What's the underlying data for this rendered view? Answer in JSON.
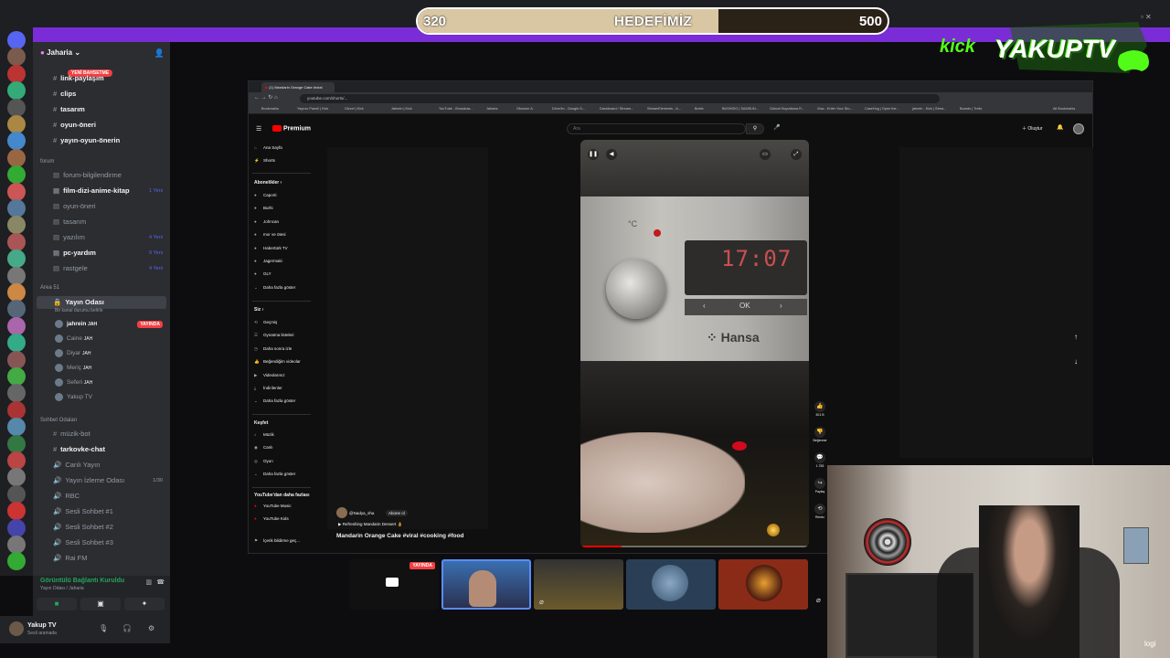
{
  "goal": {
    "current": "320",
    "label": "HEDEFİMİZ",
    "max": "500",
    "progress": 0.64
  },
  "kick_label": "kick",
  "logo_text": "YAKUPTV",
  "discord": {
    "server_name": "Jaharia",
    "new_badge": "YENİ BAHSETME",
    "channels": [
      {
        "label": "link-paylaşım",
        "bold": true
      },
      {
        "label": "clips",
        "bold": true
      },
      {
        "label": "tasarım",
        "bold": true
      },
      {
        "label": "oyun-öneri",
        "bold": true
      },
      {
        "label": "yayın-oyun-önerin",
        "bold": true
      }
    ],
    "forum_cat": "forum",
    "forum": [
      {
        "label": "forum-bilgilendirme",
        "bold": false,
        "count": ""
      },
      {
        "label": "film-dizi-anime-kitap",
        "bold": true,
        "count": "1 Yeni"
      },
      {
        "label": "oyun-öneri",
        "bold": false,
        "count": ""
      },
      {
        "label": "tasarım",
        "bold": false,
        "count": ""
      },
      {
        "label": "yazılım",
        "bold": false,
        "count": "4 Yeni"
      },
      {
        "label": "pc-yardım",
        "bold": true,
        "count": "9 Yeni"
      },
      {
        "label": "rastgele",
        "bold": false,
        "count": "4 Yeni"
      }
    ],
    "area_cat": "Area 51",
    "voice_room": "Yayın Odası",
    "voice_status": "Bir kanal durumu belirle",
    "voice_users": [
      {
        "name": "jahrein",
        "tag": "JAH",
        "live": "YAYINDA"
      },
      {
        "name": "Caine",
        "tag": "JAH",
        "live": ""
      },
      {
        "name": "Diyar",
        "tag": "JAH",
        "live": ""
      },
      {
        "name": "Meriç",
        "tag": "JAH",
        "live": ""
      },
      {
        "name": "Seferi",
        "tag": "JAH",
        "live": ""
      },
      {
        "name": "Yakup TV",
        "tag": "",
        "live": ""
      }
    ],
    "chat_cat": "Sohbet Odaları",
    "chat": [
      {
        "label": "müzik-bot",
        "bold": false,
        "count": ""
      },
      {
        "label": "tarkovke-chat",
        "bold": true,
        "count": ""
      },
      {
        "label": "Canlı Yayın",
        "bold": false,
        "count": ""
      },
      {
        "label": "Yayın İzleme Odası",
        "bold": false,
        "count": "1/30"
      },
      {
        "label": "RBC",
        "bold": false,
        "count": ""
      },
      {
        "label": "Sesli Sohbet #1",
        "bold": false,
        "count": ""
      },
      {
        "label": "Sesli Sohbet #2",
        "bold": false,
        "count": ""
      },
      {
        "label": "Sesli Sohbet #3",
        "bold": false,
        "count": ""
      },
      {
        "label": "Rai FM",
        "bold": false,
        "count": ""
      }
    ],
    "voice_connected": "Görüntülü Bağlantı Kuruldu",
    "voice_connected_sub": "Yayın Odası / Jaharia",
    "user_name": "Yakup TV",
    "user_status": "Sesli aramada"
  },
  "browser": {
    "tab_title": "(1) Mandarin Orange Cake #viral",
    "url": "youtube.com/shorts/...",
    "bookmarks": [
      "Bookmarks",
      "Yayıncı Paneli | Kick",
      "Gizzel | Kick",
      "Jahrein | Kick",
      "YouTube - Broadcas...",
      "Jaharia",
      "Okunum A.",
      "Drive'im - Google D...",
      "Dashboard / Stream...",
      "StreamElements - A...",
      "Botrix",
      "BUSHIDO | SAMSUN...",
      "Güncel Boyutlama R...",
      "Xtac - Enter Your Sto...",
      "CaseHug | Open the...",
      "jahrein - Kick | Strea...",
      "Boards | Trello",
      "All Bookmarks"
    ],
    "all_bookmarks": "All Bookmarks"
  },
  "youtube": {
    "logo": "Premium",
    "search_placeholder": "Ara",
    "create": "Oluştur",
    "nav": [
      "Ana Sayfa",
      "Shorts"
    ],
    "subs_header": "Abonelikler",
    "subs": [
      "Caporti",
      "Burhi",
      "Johncan",
      "mor ve ötesi",
      "Habertürk TV",
      "Jagermaki",
      "GLY",
      "Daha fazla göster"
    ],
    "you_header": "Siz",
    "you": [
      "Geçmiş",
      "Oynatma listeleri",
      "Daha sonra izle",
      "Beğendiğim videolar",
      "Videolarınız",
      "İndirilenler",
      "Daha fazla göster"
    ],
    "explore_header": "Keşfet",
    "explore": [
      "Müzik",
      "Canlı",
      "Oyun",
      "Daha fazla göster"
    ],
    "more_header": "YouTube'dan daha fazlası",
    "more": [
      "YouTube Music",
      "YouTube Kids"
    ],
    "report": "İçerik bildirme geç...",
    "short": {
      "channel": "@Nadya_sha",
      "subscribe": "Abone ol",
      "music": "▶ Refreshing Mandarin Dessert 👌",
      "title": "Mandarin Orange Cake #viral #cooking #food",
      "likes": "301 B",
      "dislike": "Beğenme",
      "comments": "1.783",
      "share": "Paylaş",
      "remix": "Remix"
    },
    "oven": {
      "unit": "°C",
      "time": "17:07",
      "ok": "OK",
      "brand": "Hansa"
    }
  },
  "streams": {
    "live_label": "YAYINDA"
  },
  "webcam": {
    "brand": "logi"
  }
}
